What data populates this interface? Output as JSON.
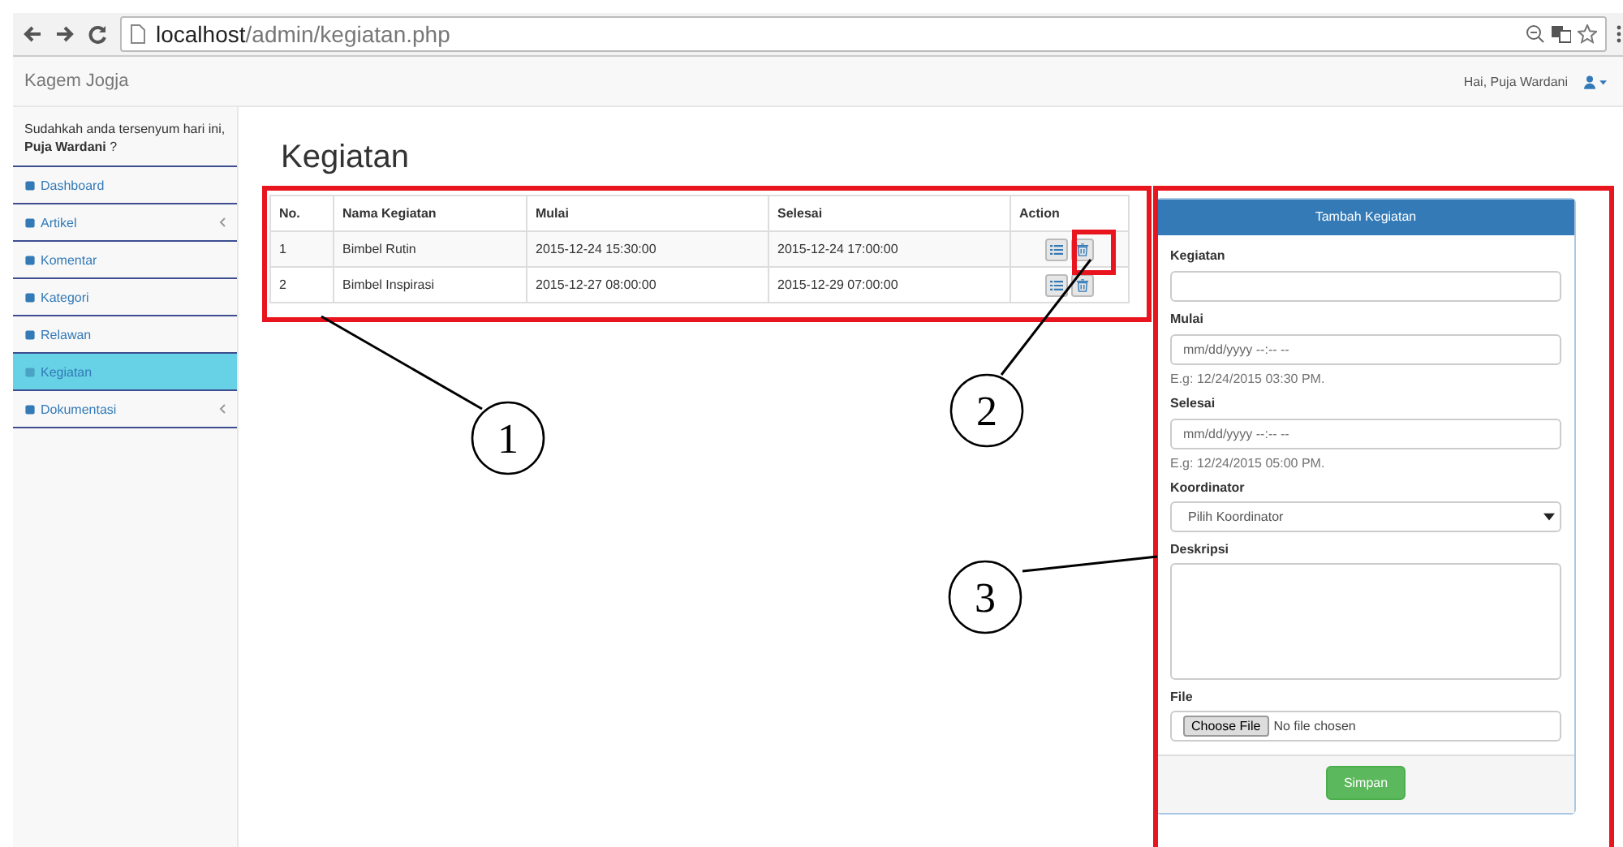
{
  "browser": {
    "url_host": "localhost",
    "url_path": "/admin/kegiatan.php"
  },
  "navbar": {
    "brand": "Kagem Jogja",
    "greeting": "Hai, Puja Wardani"
  },
  "sidebar": {
    "greeting": "Sudahkah anda tersenyum hari ini, **Puja Wardani** ?",
    "items": [
      {
        "label": "Dashboard",
        "expandable": false,
        "selected": false
      },
      {
        "label": "Artikel",
        "expandable": true,
        "selected": false
      },
      {
        "label": "Komentar",
        "expandable": false,
        "selected": false
      },
      {
        "label": "Kategori",
        "expandable": false,
        "selected": false
      },
      {
        "label": "Relawan",
        "expandable": false,
        "selected": false
      },
      {
        "label": "Kegiatan",
        "expandable": false,
        "selected": true
      },
      {
        "label": "Dokumentasi",
        "expandable": true,
        "selected": false
      }
    ]
  },
  "page": {
    "title": "Kegiatan"
  },
  "table": {
    "columns": [
      "No.",
      "Nama Kegiatan",
      "Mulai",
      "Selesai",
      "Action"
    ],
    "rows": [
      {
        "cells": [
          "1",
          "Bimbel Rutin",
          "2015-12-24 15:30:00",
          "2015-12-24 17:00:00"
        ]
      },
      {
        "cells": [
          "2",
          "Bimbel Inspirasi",
          "2015-12-27 08:00:00",
          "2015-12-29 07:00:00"
        ]
      }
    ]
  },
  "form": {
    "title": "Tambah Kegiatan",
    "fields": [
      {
        "kind": "text",
        "label": "Kegiatan"
      },
      {
        "kind": "datetime",
        "label": "Mulai",
        "placeholder": "mm/dd/yyyy --:-- --",
        "hint": "E.g: 12/24/2015 03:30 PM."
      },
      {
        "kind": "datetime",
        "label": "Selesai",
        "placeholder": "mm/dd/yyyy --:-- --",
        "hint": "E.g: 12/24/2015 05:00 PM."
      },
      {
        "kind": "select",
        "label": "Koordinator",
        "value": "Pilih Koordinator"
      },
      {
        "kind": "textarea",
        "label": "Deskripsi"
      },
      {
        "kind": "file",
        "label": "File",
        "button": "Choose File",
        "status": "No file chosen"
      }
    ],
    "submit": "Simpan"
  },
  "annotations": [
    {
      "label": "1"
    },
    {
      "label": "2"
    },
    {
      "label": "3"
    }
  ]
}
